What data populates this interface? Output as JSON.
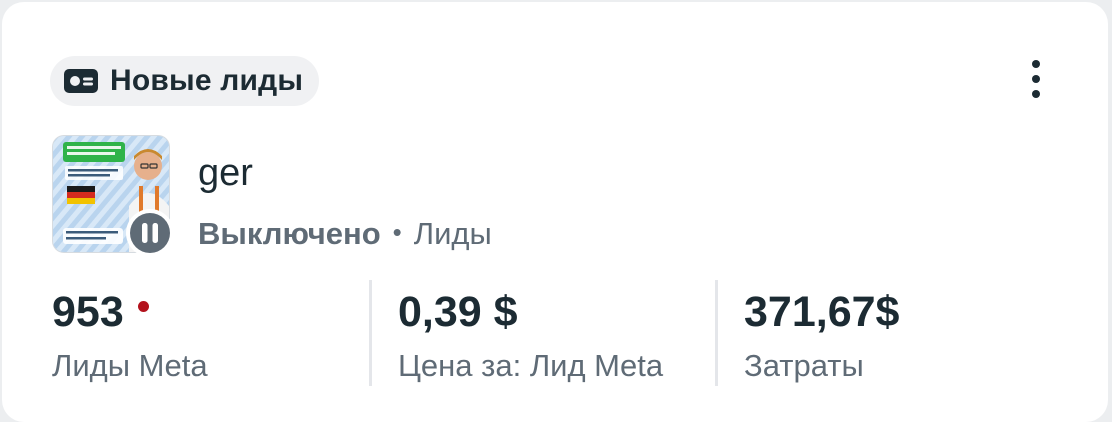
{
  "header": {
    "badge_icon": "lead-form-icon",
    "badge_label": "Новые лиды",
    "more_icon": "more-vertical-icon"
  },
  "ad": {
    "name": "ger",
    "status": "Выключено",
    "separator": "•",
    "objective": "Лиды",
    "status_icon": "pause-icon"
  },
  "metrics": [
    {
      "value": "953",
      "label": "Лиды Meta",
      "indicator_color": "#b3121d"
    },
    {
      "value": "0,39 $",
      "label": "Цена за: Лид Meta"
    },
    {
      "value": "371,67$",
      "label": "Затраты"
    }
  ],
  "colors": {
    "text_primary": "#1c2b33",
    "text_secondary": "#5f6b76",
    "alert_dot": "#b3121d"
  }
}
